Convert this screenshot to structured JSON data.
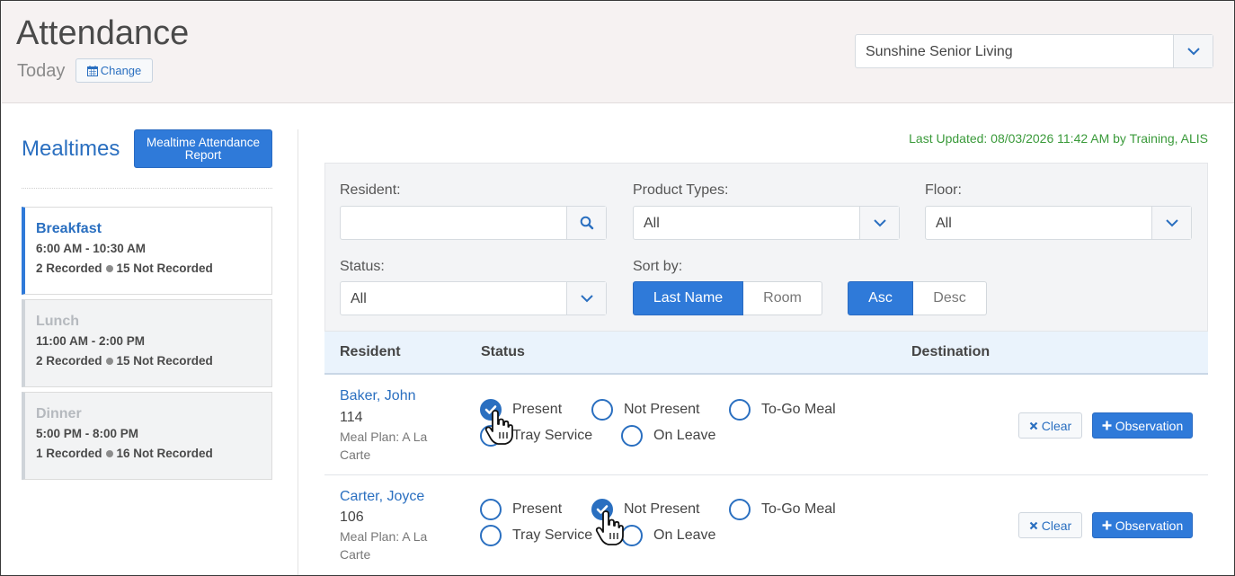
{
  "header": {
    "title": "Attendance",
    "subtitle": "Today",
    "change_label": "Change",
    "community": "Sunshine Senior Living"
  },
  "sidebar": {
    "title": "Mealtimes",
    "report_button": "Mealtime Attendance Report",
    "meals": [
      {
        "name": "Breakfast",
        "time": "6:00 AM - 10:30 AM",
        "recorded": "2 Recorded",
        "not_recorded": "15 Not Recorded",
        "active": true
      },
      {
        "name": "Lunch",
        "time": "11:00 AM - 2:00 PM",
        "recorded": "2 Recorded",
        "not_recorded": "15 Not Recorded",
        "active": false
      },
      {
        "name": "Dinner",
        "time": "5:00 PM - 8:00 PM",
        "recorded": "1 Recorded",
        "not_recorded": "16 Not Recorded",
        "active": false
      }
    ]
  },
  "last_updated": "Last Updated: 08/03/2026 11:42 AM by Training, ALIS",
  "filters": {
    "resident_label": "Resident:",
    "resident_value": "",
    "product_types_label": "Product Types:",
    "product_types_value": "All",
    "floor_label": "Floor:",
    "floor_value": "All",
    "status_label": "Status:",
    "status_value": "All",
    "sort_label": "Sort by:",
    "sort_options": [
      "Last Name",
      "Room"
    ],
    "sort_selected": "Last Name",
    "order_options": [
      "Asc",
      "Desc"
    ],
    "order_selected": "Asc"
  },
  "table": {
    "headers": [
      "Resident",
      "Status",
      "Destination"
    ],
    "status_options": [
      "Present",
      "Not Present",
      "To-Go Meal",
      "Tray Service",
      "On Leave"
    ],
    "clear_label": "Clear",
    "observation_label": "Observation",
    "rows": [
      {
        "name": "Baker, John",
        "room": "114",
        "plan": "Meal Plan: A La Carte",
        "status": "Present"
      },
      {
        "name": "Carter, Joyce",
        "room": "106",
        "plan": "Meal Plan: A La Carte",
        "status": "Not Present"
      }
    ]
  },
  "icons": {
    "calendar": "calendar-icon",
    "chevron": "chevron-down-icon",
    "search": "search-icon",
    "clear": "x-icon",
    "plus": "plus-icon",
    "cursor": "hand-pointer-icon"
  },
  "colors": {
    "accent": "#2f7ad9",
    "link": "#2a6fc0",
    "updated_text": "#3a9a3a",
    "header_bg": "#f6f2f2"
  }
}
